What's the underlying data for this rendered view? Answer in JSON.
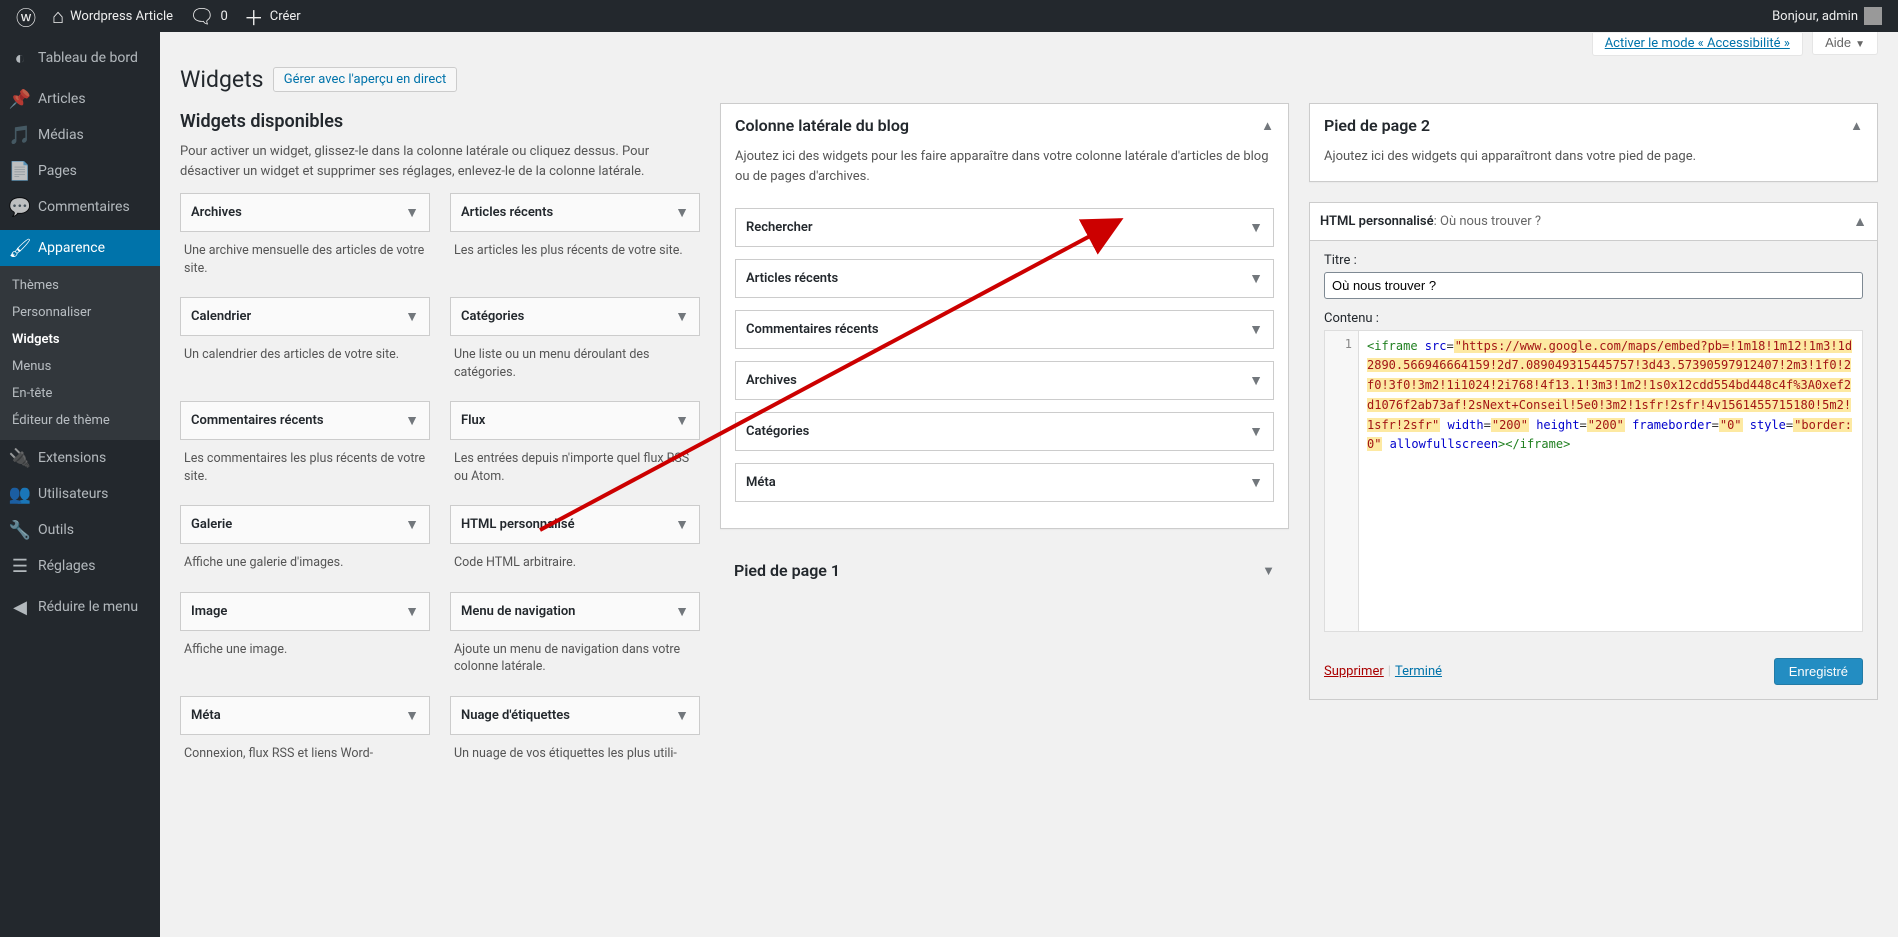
{
  "adminbar": {
    "site_name": "Wordpress Article",
    "comment_count": "0",
    "create": "Créer",
    "greeting": "Bonjour, admin"
  },
  "menu": {
    "dashboard": "Tableau de bord",
    "posts": "Articles",
    "media": "Médias",
    "pages": "Pages",
    "comments": "Commentaires",
    "appearance": "Apparence",
    "appearance_sub": {
      "themes": "Thèmes",
      "customize": "Personnaliser",
      "widgets": "Widgets",
      "menus": "Menus",
      "header": "En-tête",
      "editor": "Éditeur de thème"
    },
    "plugins": "Extensions",
    "users": "Utilisateurs",
    "tools": "Outils",
    "settings": "Réglages",
    "collapse": "Réduire le menu"
  },
  "screen_meta": {
    "accessibility": "Activer le mode « Accessibilité »",
    "help": "Aide"
  },
  "page": {
    "title": "Widgets",
    "live_preview": "Gérer avec l'aperçu en direct"
  },
  "available": {
    "heading": "Widgets disponibles",
    "description": "Pour activer un widget, glissez-le dans la colonne latérale ou cliquez dessus. Pour désactiver un widget et supprimer ses réglages, enlevez-le de la colonne latérale.",
    "widgets": [
      {
        "title": "Archives",
        "desc": "Une archive mensuelle des articles de votre site."
      },
      {
        "title": "Articles récents",
        "desc": "Les articles les plus récents de votre site."
      },
      {
        "title": "Calendrier",
        "desc": "Un calendrier des articles de votre site."
      },
      {
        "title": "Catégories",
        "desc": "Une liste ou un menu déroulant des catégories."
      },
      {
        "title": "Commentaires récents",
        "desc": "Les commentaires les plus récents de votre site."
      },
      {
        "title": "Flux",
        "desc": "Les entrées depuis n'importe quel flux RSS ou Atom."
      },
      {
        "title": "Galerie",
        "desc": "Affiche une galerie d'images."
      },
      {
        "title": "HTML personnalisé",
        "desc": "Code HTML arbitraire."
      },
      {
        "title": "Image",
        "desc": "Affiche une image."
      },
      {
        "title": "Menu de navigation",
        "desc": "Ajoute un menu de navigation dans votre colonne latérale."
      },
      {
        "title": "Méta",
        "desc": "Connexion, flux RSS et liens Word-"
      },
      {
        "title": "Nuage d'étiquettes",
        "desc": "Un nuage de vos étiquettes les plus utili-"
      }
    ]
  },
  "zones": {
    "blog_sidebar": {
      "title": "Colonne latérale du blog",
      "desc": "Ajoutez ici des widgets pour les faire apparaître dans votre colonne latérale d'articles de blog ou de pages d'archives.",
      "widgets": [
        "Rechercher",
        "Articles récents",
        "Commentaires récents",
        "Archives",
        "Catégories",
        "Méta"
      ]
    },
    "footer1": {
      "title": "Pied de page 1"
    },
    "footer2": {
      "title": "Pied de page 2",
      "desc": "Ajoutez ici des widgets qui apparaîtront dans votre pied de page."
    }
  },
  "editor": {
    "widget_name": "HTML personnalisé",
    "widget_subtitle": "Où nous trouver ?",
    "title_label": "Titre :",
    "title_value": "Où nous trouver ?",
    "content_label": "Contenu :",
    "code_line_num": "1",
    "code": {
      "p1_tag": "<iframe",
      "p1_attr": " src",
      "p1_val": "\"https://www.google.com/maps/embed?pb=!1m18!1m12!1m3!1d2890.566946664159!2d7.089049315445757!3d43.57390597912407!2m3!1f0!2f0!3f0!3m2!1i1024!2i768!4f13.1!3m3!1m2!1s0x12cdd554bd448c4f%3A0xef2d1076f2ab73af!2sNext+Conseil!5e0!3m2!1sfr!2sfr!4v1561455715180!5m2!1sfr!2sfr\"",
      "p2_attr": " width",
      "p2_val": "\"200\"",
      "p3_attr": " height",
      "p3_val": "\"200\"",
      "p4_attr": " frameborder",
      "p4_val": "\"0\"",
      "p5_attr": " style",
      "p5_val": "\"border:0\"",
      "p6_attr": " allowfullscreen",
      "p7_tag": "></iframe>"
    },
    "delete": "Supprimer",
    "done": "Terminé",
    "save": "Enregistré"
  }
}
